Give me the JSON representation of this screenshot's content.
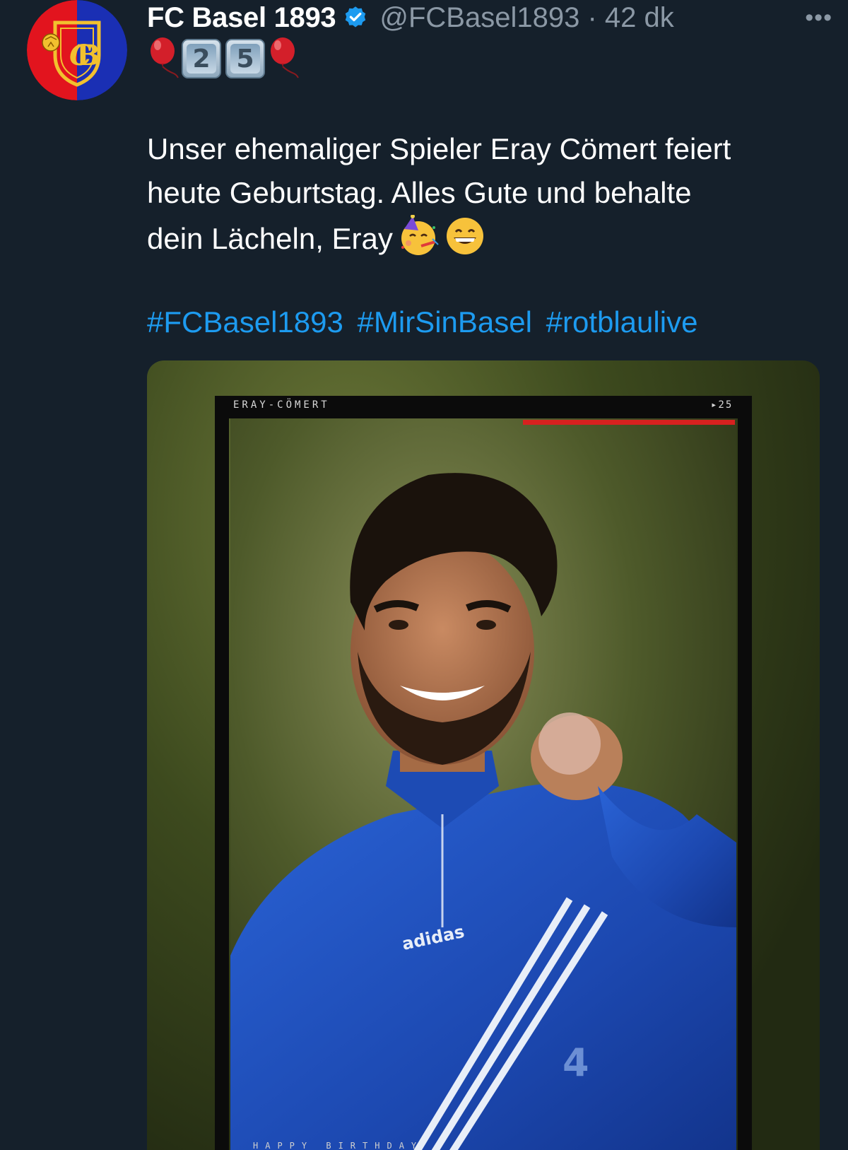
{
  "tweet": {
    "author": {
      "display_name": "FC Basel 1893",
      "handle": "@FCBasel1893",
      "separator": "·",
      "time": "42 dk",
      "verified": true,
      "avatar_icon": "fc-basel-crest-icon"
    },
    "more_icon": "more-options-icon",
    "more_label": "•••",
    "emoji_line": {
      "balloon_icon": "red-balloon-icon",
      "keycaps": [
        "2",
        "5"
      ]
    },
    "body": {
      "paragraph_lines": [
        "Unser ehemaliger Spieler Eray Cömert feiert",
        "heute Geburtstag. Alles Gute und behalte",
        "dein Lächeln, Eray"
      ],
      "trailing_emojis": [
        "partying-face-icon",
        "grinning-face-icon"
      ]
    },
    "hashtags": [
      "#FCBasel1893",
      "#MirSinBasel",
      "#rotblaulive"
    ],
    "media": {
      "frame_caption": "ERAY-CÖMERT",
      "frame_number": "▸25",
      "bottom_caption": "HAPPY BIRTHDAY",
      "jersey_brand": "adidas",
      "jersey_number": "4"
    }
  },
  "colors": {
    "background": "#15202b",
    "hashtag": "#1d9bf0",
    "secondary_text": "#8b98a5",
    "verified": "#1d9bf0",
    "frame_red": "#d7211f",
    "jersey_blue": "#1f4fb8"
  }
}
